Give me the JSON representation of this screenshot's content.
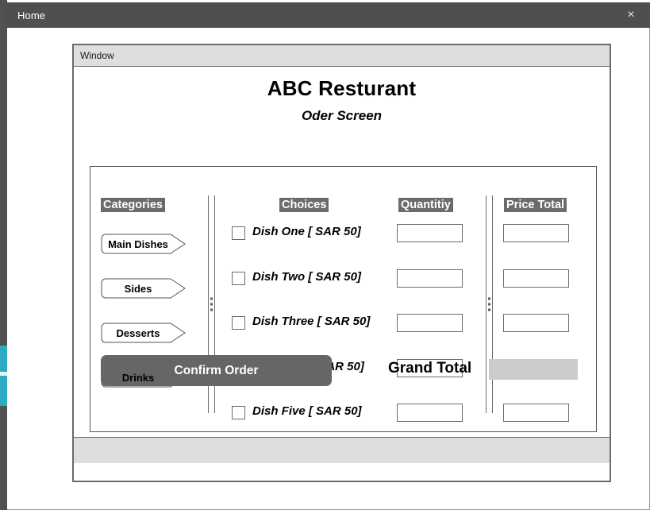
{
  "titlebar": {
    "title": "Home",
    "close_label": "×"
  },
  "inner_window": {
    "title": "Window"
  },
  "screen": {
    "title": "ABC Resturant",
    "subtitle": "Oder Screen"
  },
  "columns": {
    "categories": "Categories",
    "choices": "Choices",
    "quantity": "Quantitiy",
    "price_total": "Price Total"
  },
  "categories": [
    {
      "label": "Main Dishes"
    },
    {
      "label": "Sides"
    },
    {
      "label": "Desserts"
    },
    {
      "label": "Drinks"
    }
  ],
  "dishes": [
    {
      "label": "Dish One [ SAR 50]",
      "quantity": "",
      "price_total": ""
    },
    {
      "label": "Dish Two [ SAR 50]",
      "quantity": "",
      "price_total": ""
    },
    {
      "label": "Dish Three [ SAR 50]",
      "quantity": "",
      "price_total": ""
    },
    {
      "label": "Dish Four [ SAR 50]",
      "quantity": "",
      "price_total": ""
    },
    {
      "label": "Dish Five [ SAR 50]",
      "quantity": "",
      "price_total": ""
    }
  ],
  "footer": {
    "confirm_label": "Confirm Order",
    "grand_total_label": "Grand Total",
    "grand_total_value": ""
  },
  "colors": {
    "titlebar_bg": "#4f4f4f",
    "inner_titlebar_bg": "#dedede",
    "header_highlight": "#6b6b6b",
    "confirm_button": "#666666",
    "grand_total_field": "#cccccc",
    "accent_strip": "#2cabc3",
    "border": "#6b6b6b"
  }
}
